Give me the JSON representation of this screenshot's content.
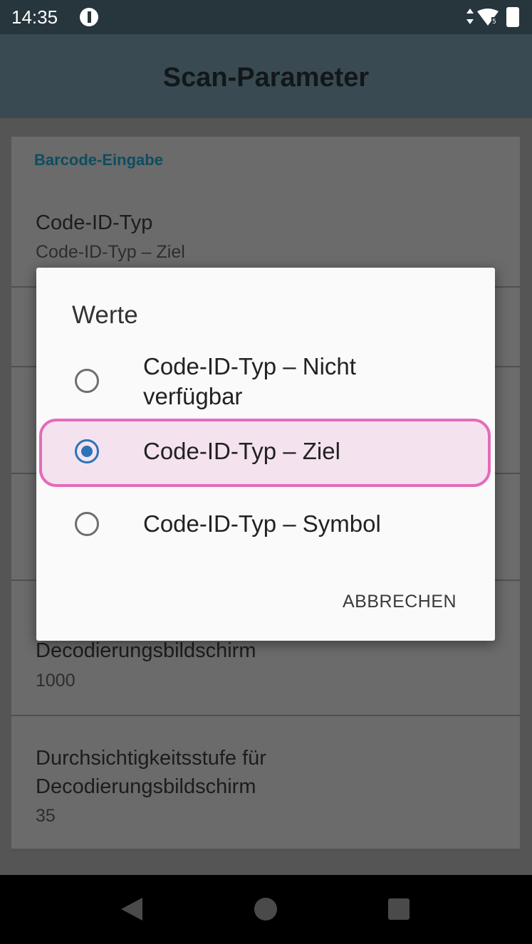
{
  "status_bar": {
    "time": "14:35",
    "icons": [
      "app-notification-icon",
      "signal-icon",
      "wifi-icon",
      "battery-icon"
    ]
  },
  "app_bar": {
    "title": "Scan-Parameter"
  },
  "preferences": {
    "category": "Barcode-Eingabe",
    "items": [
      {
        "title": "Code-ID-Typ",
        "summary": "Code-ID-Typ – Ziel"
      },
      {
        "title": "Decodierungsbildschirm",
        "summary": "1000"
      },
      {
        "title": "Durchsichtigkeitsstufe für Decodierungsbildschirm",
        "summary": "35"
      }
    ]
  },
  "dialog": {
    "title": "Werte",
    "options": [
      {
        "label": "Code-ID-Typ – Nicht verfügbar",
        "selected": false
      },
      {
        "label": "Code-ID-Typ – Ziel",
        "selected": true
      },
      {
        "label": "Code-ID-Typ – Symbol",
        "selected": false
      }
    ],
    "cancel_label": "ABBRECHEN"
  },
  "colors": {
    "accent": "#2a73b8",
    "highlight_border": "#e46bbb",
    "app_bar": "#3a4a52",
    "status_bar": "#27353d"
  }
}
